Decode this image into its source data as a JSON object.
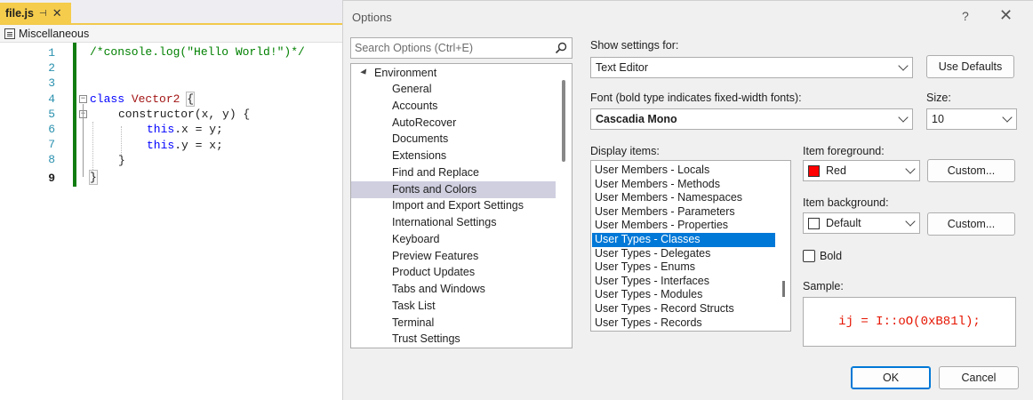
{
  "editor": {
    "tab": {
      "label": "file.js",
      "pin_icon": "⊣",
      "close_icon": "✕"
    },
    "nav_label": "Miscellaneous",
    "line_numbers": [
      "1",
      "2",
      "3",
      "4",
      "5",
      "6",
      "7",
      "8",
      "9"
    ],
    "current_line": "9",
    "code": {
      "l1": "/*console.log(\"Hello World!\")*/",
      "l4_kw": "class",
      "l4_name": "Vector2",
      "l4_brace": "{",
      "l5": "constructor(x, y) {",
      "l6_kw": "this",
      "l6_rest": ".x = y;",
      "l7_kw": "this",
      "l7_rest": ".y = x;",
      "l8": "}",
      "l9": "}"
    },
    "colors": {
      "comment": "#008000",
      "keyword": "#0000ff",
      "class_name": "#a31515",
      "line_number": "#2b91af",
      "change_bar": "#107c10"
    }
  },
  "dialog": {
    "title": "Options",
    "help": "?",
    "close": "✕",
    "search_placeholder": "Search Options (Ctrl+E)",
    "tree": {
      "root": "Environment",
      "items": [
        "General",
        "Accounts",
        "AutoRecover",
        "Documents",
        "Extensions",
        "Find and Replace",
        "Fonts and Colors",
        "Import and Export Settings",
        "International Settings",
        "Keyboard",
        "Preview Features",
        "Product Updates",
        "Tabs and Windows",
        "Task List",
        "Terminal",
        "Trust Settings"
      ],
      "selected": "Fonts and Colors"
    },
    "show_settings_label": "Show settings for:",
    "show_settings_value": "Text Editor",
    "use_defaults": "Use Defaults",
    "font_label": "Font (bold type indicates fixed-width fonts):",
    "font_value": "Cascadia Mono",
    "size_label": "Size:",
    "size_value": "10",
    "display_items_label": "Display items:",
    "display_items": [
      "User Members - Locals",
      "User Members - Methods",
      "User Members - Namespaces",
      "User Members - Parameters",
      "User Members - Properties",
      "User Types - Classes",
      "User Types - Delegates",
      "User Types - Enums",
      "User Types - Interfaces",
      "User Types - Modules",
      "User Types - Record Structs",
      "User Types - Records"
    ],
    "display_selected": "User Types - Classes",
    "foreground_label": "Item foreground:",
    "foreground_value": "Red",
    "foreground_color": "#ff0000",
    "background_label": "Item background:",
    "background_value": "Default",
    "background_color": "#ffffff",
    "custom": "Custom...",
    "bold_label": "Bold",
    "bold_checked": false,
    "sample_label": "Sample:",
    "sample_text": "ij = I::oO(0xB81l);",
    "sample_color": "#e51400",
    "ok": "OK",
    "cancel": "Cancel",
    "accent": "#0078d7"
  }
}
